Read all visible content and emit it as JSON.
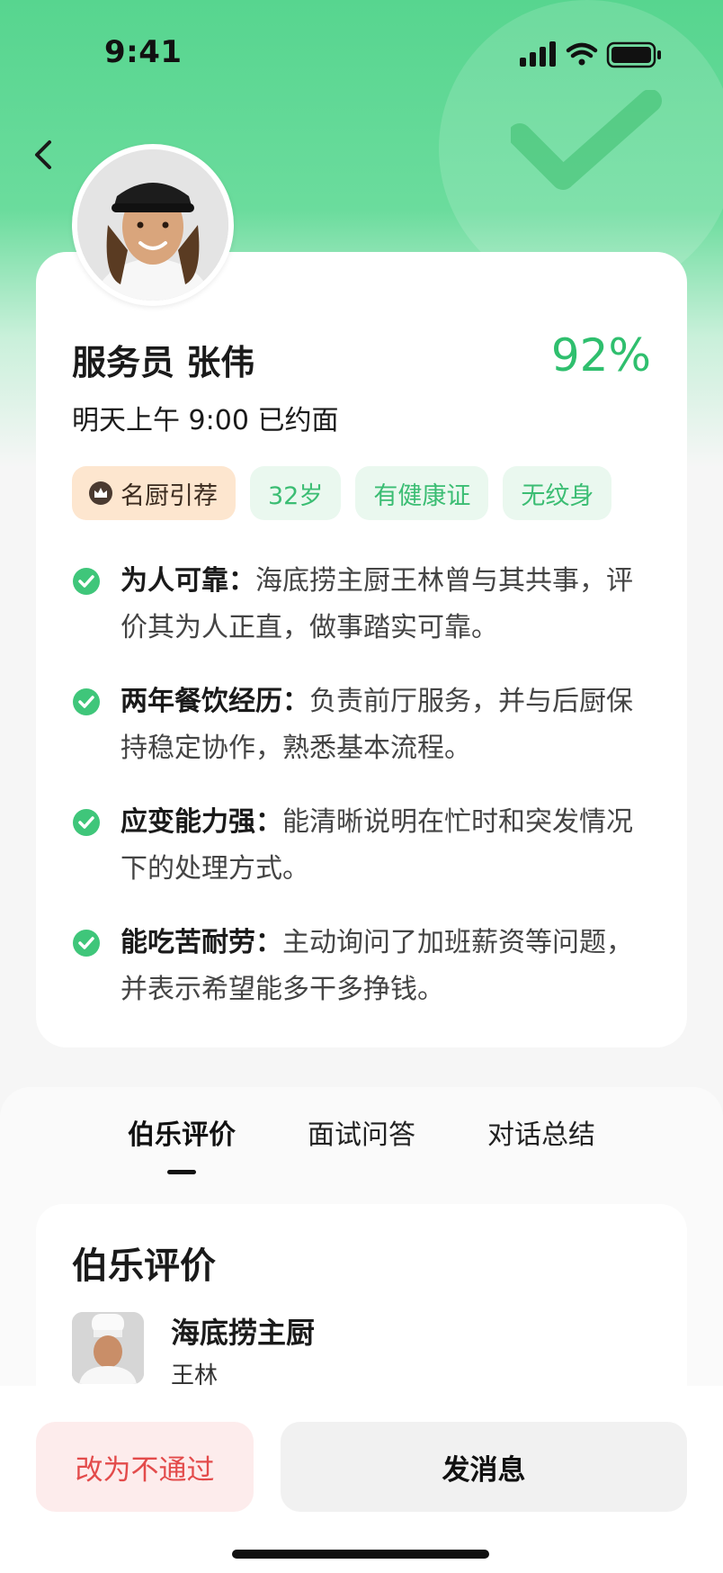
{
  "status_bar": {
    "time": "9:41",
    "icons": [
      "signal-icon",
      "wifi-icon",
      "battery-icon"
    ]
  },
  "header": {
    "back_icon": "chevron-left-icon"
  },
  "profile": {
    "name": "服务员 张伟",
    "match_percent": "92%",
    "appointment": "明天上午 9:00 已约面",
    "tags": [
      {
        "label": "名厨引荐",
        "icon": "crown-icon",
        "style": "chef"
      },
      {
        "label": "32岁"
      },
      {
        "label": "有健康证"
      },
      {
        "label": "无纹身"
      }
    ],
    "points": [
      {
        "title": "为人可靠：",
        "text": "海底捞主厨王林曾与其共事，评价其为人正直，做事踏实可靠。"
      },
      {
        "title": "两年餐饮经历：",
        "text": "负责前厅服务，并与后厨保持稳定协作，熟悉基本流程。"
      },
      {
        "title": "应变能力强：",
        "text": "能清晰说明在忙时和突发情况下的处理方式。"
      },
      {
        "title": "能吃苦耐劳：",
        "text": "主动询问了加班薪资等问题，并表示希望能多干多挣钱。"
      }
    ]
  },
  "tabs": [
    {
      "label": "伯乐评价",
      "active": true
    },
    {
      "label": "面试问答",
      "active": false
    },
    {
      "label": "对话总结",
      "active": false
    }
  ],
  "review": {
    "heading": "伯乐评价",
    "reviewer_role": "海底捞主厨",
    "reviewer_name": "王林"
  },
  "actions": {
    "reject_label": "改为不通过",
    "message_label": "发消息"
  },
  "colors": {
    "brand_green": "#2fbf6e",
    "hero_green": "#57d58f",
    "reject_red": "#e34b4b",
    "chef_tag_bg": "#fde6cf"
  }
}
